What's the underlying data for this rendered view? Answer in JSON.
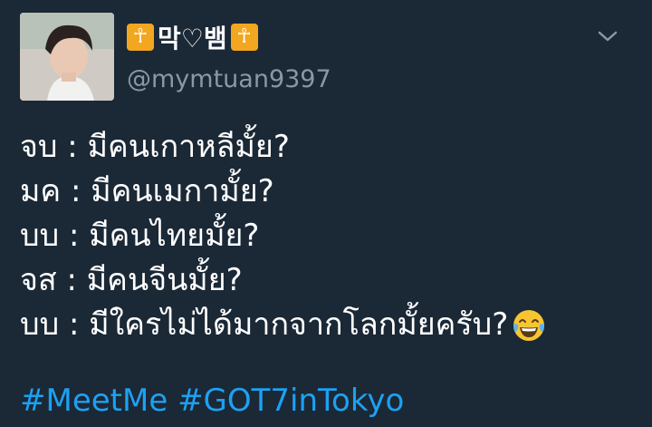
{
  "tweet": {
    "author": {
      "display_name": "막♡뱀",
      "name_emoji": "☥",
      "handle": "@mymtuan9397",
      "avatar_icon": "profile-photo"
    },
    "menu_icon": "chevron-down-icon",
    "lines": [
      {
        "text": "จบ : มีคนเกาหลีมั้ย?"
      },
      {
        "text": "มค : มีคนเมกามั้ย?"
      },
      {
        "text": "บบ : มีคนไทยมั้ย?"
      },
      {
        "text": "จส : มีคนจีนมั้ย?"
      },
      {
        "text": "บบ : มีใครไม่ได้มากจากโลกมั้ยครับ?",
        "trailing_emoji": "tears-of-joy-emoji"
      }
    ],
    "hashtags": [
      "#MeetMe",
      "#GOT7inTokyo"
    ]
  },
  "colors": {
    "background": "#1b2836",
    "text": "#ffffff",
    "handle": "#8899a6",
    "link": "#1da1f2",
    "emoji_badge": "#f3a620"
  }
}
